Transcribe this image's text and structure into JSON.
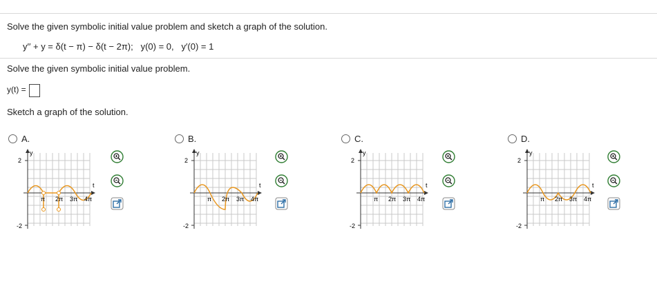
{
  "problem": {
    "instruction": "Solve the given symbolic initial value problem and sketch a graph of the solution.",
    "equation": {
      "ode": "y′′ + y = δ(t − π) − δ(t − 2π);",
      "ic1": "y(0) = 0,",
      "ic2": "y′(0) = 1"
    }
  },
  "part1": {
    "prompt": "Solve the given symbolic initial value problem.",
    "answer_label": "y(t) =",
    "answer_value": ""
  },
  "part2": {
    "prompt": "Sketch a graph of the solution."
  },
  "options": [
    {
      "letter": "A.",
      "selected": false
    },
    {
      "letter": "B.",
      "selected": false
    },
    {
      "letter": "C.",
      "selected": false
    },
    {
      "letter": "D.",
      "selected": false
    }
  ],
  "graph_labels": {
    "y_axis": "y",
    "t_axis": "t",
    "y_top": "2",
    "y_bottom": "-2",
    "ticks": [
      "π",
      "2π",
      "3π",
      "4π"
    ]
  },
  "tools": {
    "zoom_in": "zoom-in-icon",
    "zoom_out": "zoom-out-icon",
    "popout": "popout-icon"
  },
  "colors": {
    "curve": "#e8961e",
    "grid": "#c8c8c8",
    "tool_ring": "#2f7d32",
    "popout": "#2e6ea6"
  }
}
